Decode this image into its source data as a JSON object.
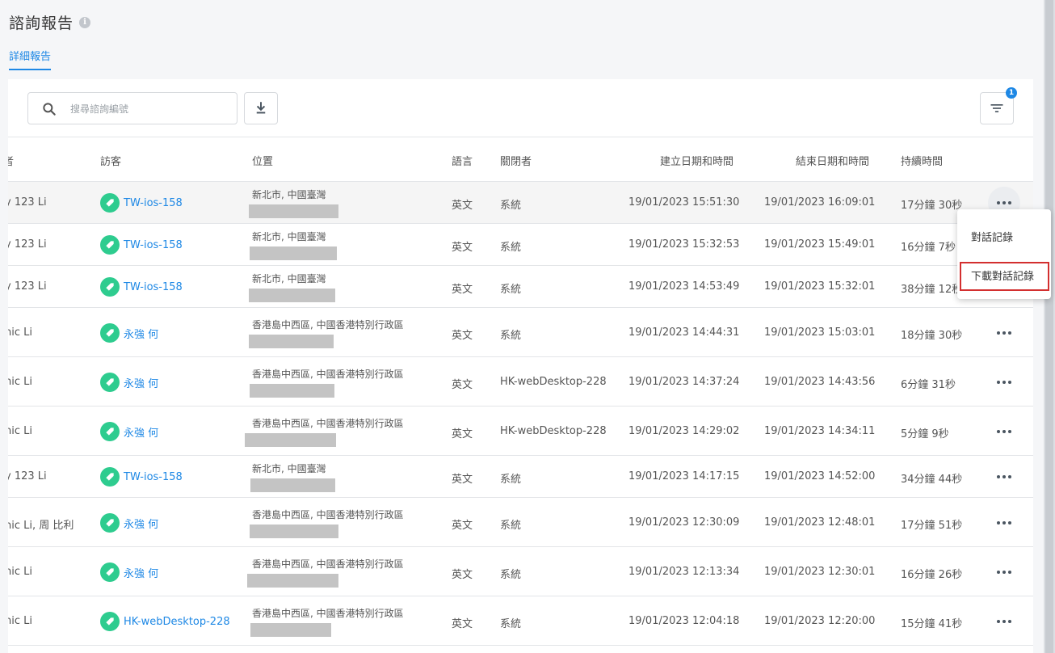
{
  "header": {
    "title": "諮詢報告",
    "info_glyph": "i",
    "tab_label": "詳細報告"
  },
  "toolbar": {
    "search_placeholder": "搜尋諮詢編號",
    "filter_count": "1"
  },
  "columns": [
    "者",
    "訪客",
    "位置",
    "語言",
    "關閉者",
    "建立日期和時間",
    "結束日期和時間",
    "持續時間"
  ],
  "rows": [
    {
      "agent": "y 123 Li",
      "visitor": "TW-ios-158",
      "location": "新北市, 中國臺灣",
      "language": "英文",
      "closer": "系統",
      "start": "19/01/2023  15:51:30",
      "end": "19/01/2023  16:09:01",
      "duration": "17分鐘 30秒"
    },
    {
      "agent": "y 123 Li",
      "visitor": "TW-ios-158",
      "location": "新北市, 中國臺灣",
      "language": "英文",
      "closer": "系統",
      "start": "19/01/2023  15:32:53",
      "end": "19/01/2023  15:49:01",
      "duration": "16分鐘 7秒"
    },
    {
      "agent": "y 123 Li",
      "visitor": "TW-ios-158",
      "location": "新北市, 中國臺灣",
      "language": "英文",
      "closer": "系統",
      "start": "19/01/2023  14:53:49",
      "end": "19/01/2023  15:32:01",
      "duration": "38分鐘 12秒"
    },
    {
      "agent": "nic Li",
      "visitor": "永強 何",
      "location": "香港島中西區, 中國香港特別行政區",
      "language": "英文",
      "closer": "系統",
      "start": "19/01/2023  14:44:31",
      "end": "19/01/2023  15:03:01",
      "duration": "18分鐘 30秒"
    },
    {
      "agent": "nic Li",
      "visitor": "永強 何",
      "location": "香港島中西區, 中國香港特別行政區",
      "language": "英文",
      "closer": "HK-webDesktop-228",
      "start": "19/01/2023  14:37:24",
      "end": "19/01/2023  14:43:56",
      "duration": "6分鐘 31秒"
    },
    {
      "agent": "nic Li",
      "visitor": "永強 何",
      "location": "香港島中西區, 中國香港特別行政區",
      "language": "英文",
      "closer": "HK-webDesktop-228",
      "start": "19/01/2023  14:29:02",
      "end": "19/01/2023  14:34:11",
      "duration": "5分鐘 9秒"
    },
    {
      "agent": "y 123 Li",
      "visitor": "TW-ios-158",
      "location": "新北市, 中國臺灣",
      "language": "英文",
      "closer": "系統",
      "start": "19/01/2023  14:17:15",
      "end": "19/01/2023  14:52:00",
      "duration": "34分鐘 44秒"
    },
    {
      "agent": "nic Li, 周 比利",
      "visitor": "永強 何",
      "location": "香港島中西區, 中國香港特別行政區",
      "language": "英文",
      "closer": "系統",
      "start": "19/01/2023  12:30:09",
      "end": "19/01/2023  12:48:01",
      "duration": "17分鐘 51秒"
    },
    {
      "agent": "nic Li",
      "visitor": "永強 何",
      "location": "香港島中西區, 中國香港特別行政區",
      "language": "英文",
      "closer": "系統",
      "start": "19/01/2023  12:13:34",
      "end": "19/01/2023  12:30:01",
      "duration": "16分鐘 26秒"
    },
    {
      "agent": "nic Li",
      "visitor": "HK-webDesktop-228",
      "location": "香港島中西區, 中國香港特別行政區",
      "language": "英文",
      "closer": "系統",
      "start": "19/01/2023  12:04:18",
      "end": "19/01/2023  12:20:00",
      "duration": "15分鐘 41秒"
    }
  ],
  "context_menu": {
    "item_chat_log": "對話記錄",
    "item_download_chat_log": "下載對話記錄"
  },
  "colors": {
    "accent": "#1e88e5",
    "visitor_icon": "#2ecc8f",
    "highlight": "#d32f2f"
  }
}
